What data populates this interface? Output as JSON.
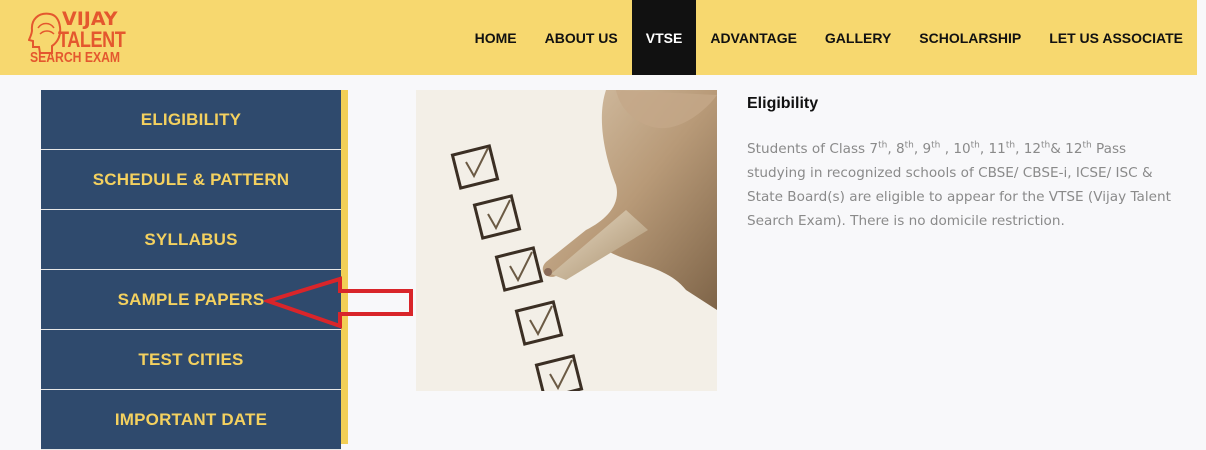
{
  "logo": {
    "line1": "VIJAY",
    "line2": "TALENT",
    "line3": "SEARCH EXAM"
  },
  "nav": {
    "items": [
      {
        "label": "HOME"
      },
      {
        "label": "ABOUT US"
      },
      {
        "label": "VTSE",
        "active": true
      },
      {
        "label": "ADVANTAGE"
      },
      {
        "label": "GALLERY"
      },
      {
        "label": "SCHOLARSHIP"
      },
      {
        "label": "LET US ASSOCIATE"
      }
    ]
  },
  "sidebar": {
    "items": [
      {
        "label": "ELIGIBILITY"
      },
      {
        "label": "SCHEDULE & PATTERN"
      },
      {
        "label": "SYLLABUS"
      },
      {
        "label": "SAMPLE PAPERS"
      },
      {
        "label": "TEST CITIES"
      },
      {
        "label": "IMPORTANT DATE"
      }
    ]
  },
  "content": {
    "heading": "Eligibility",
    "paragraph": {
      "t1": "Students of Class 7",
      "s1": "th",
      "t2": ", 8",
      "s2": "th",
      "t3": ", 9",
      "s3": "th",
      "t4": " , 10",
      "s4": "th",
      "t5": ", 11",
      "s5": "th",
      "t6": ", 12",
      "s6": "th",
      "t7": "& 12",
      "s7": "th",
      "t8": " Pass studying in recognized schools of CBSE/ CBSE-i, ICSE/ ISC & State Board(s) are eligible to appear for the VTSE (Vijay Talent Search Exam). There is no domicile restriction."
    }
  },
  "colors": {
    "header_bg": "#f7d86f",
    "sidebar_bg": "#2f4a6d",
    "sidebar_text": "#f4d15f",
    "active_nav_bg": "#111111",
    "arrow": "#d9252a"
  }
}
